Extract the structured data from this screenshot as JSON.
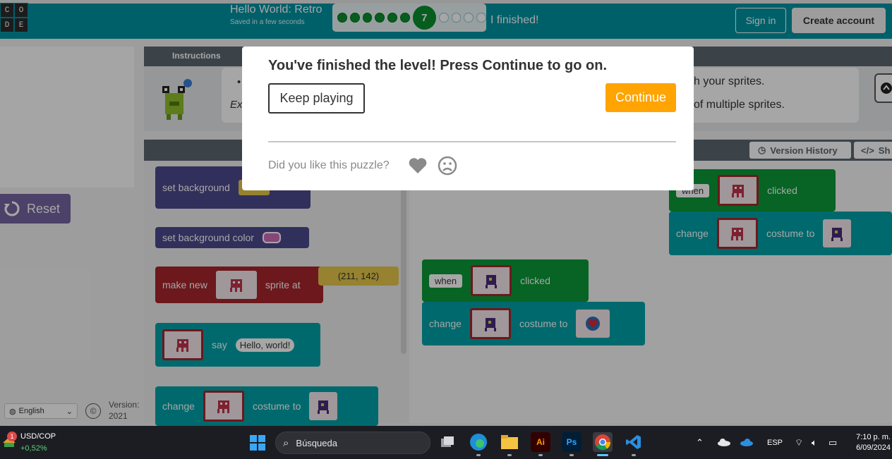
{
  "header": {
    "logo_letters": [
      "C",
      "O",
      "D",
      "E"
    ],
    "title": "Hello World: Retro",
    "saved_status": "Saved in a few seconds",
    "current_level": "7",
    "finished_label": "I finished!",
    "sign_in": "Sign in",
    "create_account": "Create account"
  },
  "left": {
    "reset_label": "Reset",
    "language": "English",
    "copyright_symbol": "©",
    "version_label": "Version:",
    "version_value": "2021"
  },
  "instructions": {
    "tab": "Instructions",
    "bullet": "•",
    "example_prefix": "Ex",
    "text_fragment_1": "h your sprites.",
    "text_fragment_2": "of multiple sprites."
  },
  "workspace_toolbar": {
    "version_history": "Version History",
    "show_code_prefix": "Sh"
  },
  "toolbox_blocks": {
    "set_background": "set background",
    "set_background_color": "set background color",
    "make_new": "make new",
    "sprite_at": "sprite at",
    "coord": "(211, 142)",
    "say": "say",
    "say_text": "Hello, world!",
    "change": "change",
    "costume_to": "costume to"
  },
  "workspace_blocks": {
    "when": "when",
    "clicked": "clicked",
    "change": "change",
    "costume_to": "costume to"
  },
  "dialog": {
    "title": "You've finished the level! Press Continue to go on.",
    "keep_playing": "Keep playing",
    "continue": "Continue",
    "question": "Did you like this puzzle?"
  },
  "taskbar": {
    "widget_badge": "1",
    "currency_pair": "USD/COP",
    "currency_change": "+0,52%",
    "search_placeholder": "Búsqueda",
    "language": "ESP",
    "time": "7:10 p. m.",
    "date": "6/09/2024"
  },
  "colors": {
    "header_teal": "#0094a3",
    "continue_orange": "#ffa400",
    "progress_green": "#0a8f2e"
  }
}
